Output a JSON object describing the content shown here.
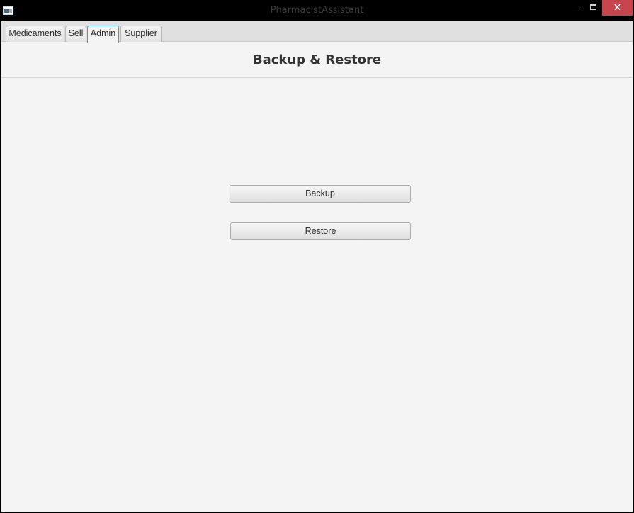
{
  "window": {
    "title": "PharmacistAssistant",
    "close_glyph": "✕"
  },
  "tabs": [
    {
      "label": "Medicaments",
      "active": false
    },
    {
      "label": "Sell",
      "active": false
    },
    {
      "label": "Admin",
      "active": true
    },
    {
      "label": "Supplier",
      "active": false
    }
  ],
  "page": {
    "title": "Backup & Restore"
  },
  "actions": {
    "backup_label": "Backup",
    "restore_label": "Restore"
  },
  "colors": {
    "active_tab_border": "#3c9bd6",
    "close_button": "#c7464d",
    "background": "#f4f4f4"
  }
}
